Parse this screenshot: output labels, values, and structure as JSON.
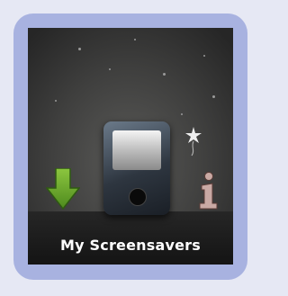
{
  "widget": {
    "title": "My Screensavers",
    "page_indicator_icon": "page-dot-icon",
    "close_icon": "close-icon",
    "close_glyph": "✕"
  },
  "icons": {
    "download": "download-arrow-icon",
    "device": "media-player-icon",
    "info": "info-icon",
    "decoration": "fairy-icon"
  },
  "colors": {
    "frame": "#a8b2e0",
    "background": "#e6e8f4",
    "arrow": "#6fae2a",
    "info": "#c9a9a4",
    "title": "#ffffff"
  }
}
